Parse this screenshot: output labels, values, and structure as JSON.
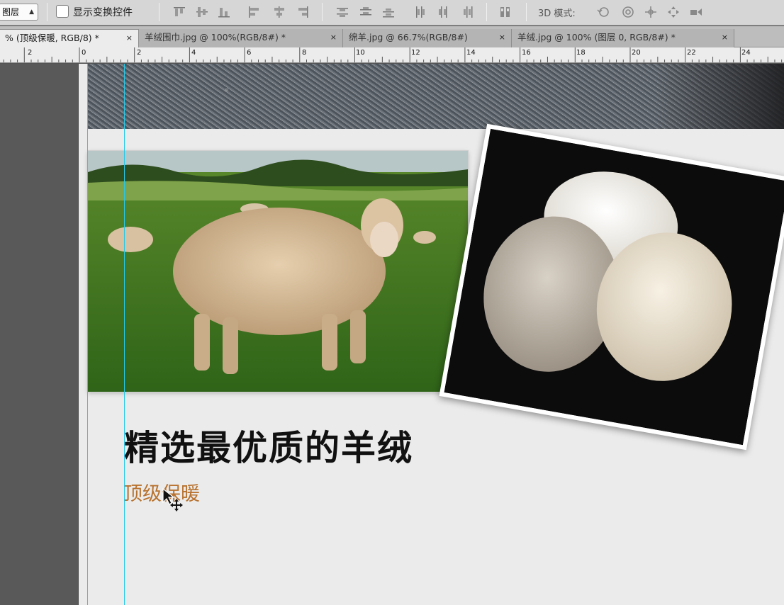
{
  "options_bar": {
    "layer_select_value": "图层",
    "show_transform_label": "显示变换控件",
    "mode_label": "3D 模式:",
    "icons": [
      "align-top-edges-icon",
      "align-vertical-centers-icon",
      "align-bottom-edges-icon",
      "align-left-edges-icon",
      "align-horizontal-centers-icon",
      "align-right-edges-icon",
      "distribute-top-icon",
      "distribute-vcenter-icon",
      "distribute-bottom-icon",
      "distribute-left-icon",
      "distribute-hcenter-icon",
      "distribute-right-icon",
      "auto-align-icon",
      "3d-rotate-icon",
      "3d-roll-icon",
      "3d-pan-icon",
      "3d-slide-icon",
      "3d-scale-icon"
    ]
  },
  "tabs": [
    {
      "label": "% (顶级保暖, RGB/8) *",
      "close": "×",
      "active": true
    },
    {
      "label": "羊绒围巾.jpg @ 100%(RGB/8#) *",
      "close": "×",
      "active": false
    },
    {
      "label": "绵羊.jpg @ 66.7%(RGB/8#)",
      "close": "×",
      "active": false
    },
    {
      "label": "羊绒.jpg @ 100% (图层 0, RGB/8#) *",
      "close": "×",
      "active": false
    }
  ],
  "ruler": {
    "labels": [
      "2",
      "0",
      "2",
      "4",
      "6",
      "8",
      "10",
      "12",
      "14",
      "16",
      "18",
      "20",
      "22",
      "24"
    ]
  },
  "document": {
    "headline": "精选最优质的羊绒",
    "subline": "顶级保暖",
    "guide_color": "#26c9e9",
    "subline_color": "#b8722e"
  }
}
